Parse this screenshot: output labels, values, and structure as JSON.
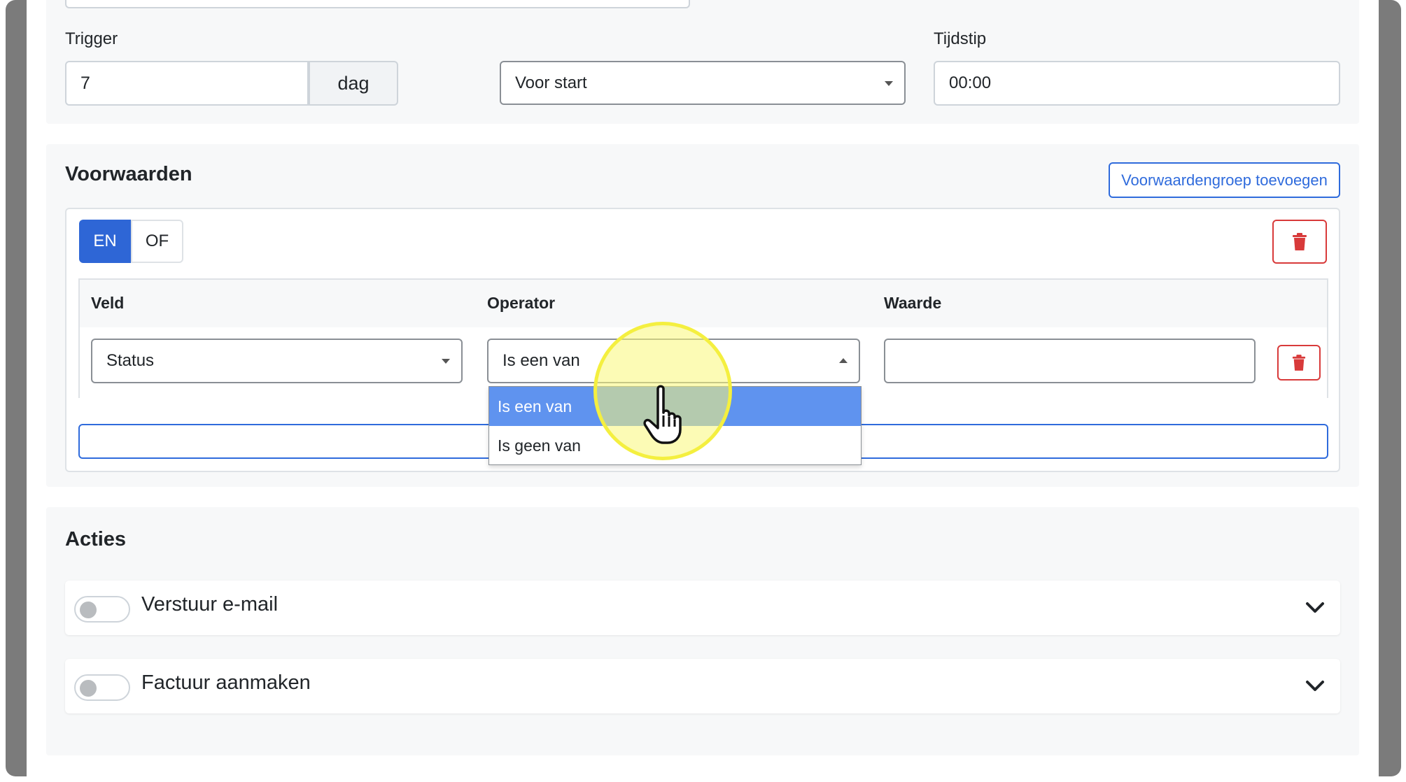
{
  "trigger": {
    "label": "Trigger",
    "amount_value": "7",
    "unit": "dag",
    "relation_value": "Voor start",
    "time_label": "Tijdstip",
    "time_value": "00:00"
  },
  "voorwaarden": {
    "title": "Voorwaarden",
    "add_group_label": "Voorwaardengroep toevoegen",
    "logic": {
      "and_label": "EN",
      "or_label": "OF",
      "selected": "EN"
    },
    "table": {
      "headers": [
        "Veld",
        "Operator",
        "Waarde"
      ],
      "row": {
        "field_value": "Status",
        "operator_value": "Is een van",
        "value_value": ""
      }
    },
    "operator_dropdown": {
      "open": true,
      "options": [
        "Is een van",
        "Is geen van"
      ],
      "selected": "Is een van"
    }
  },
  "acties": {
    "title": "Acties",
    "items": [
      {
        "label": "Verstuur e-mail",
        "enabled": false
      },
      {
        "label": "Factuur aanmaken",
        "enabled": false
      }
    ]
  },
  "colors": {
    "primary": "#2e66d6",
    "danger": "#d83a3a",
    "dropdown_active": "#5f93ef",
    "highlight": "#f4ef3f",
    "panel": "#f7f8f9"
  },
  "icons": [
    "trash-icon",
    "chevron-down-icon",
    "caret-down-icon",
    "caret-up-icon",
    "pointer-hand-icon"
  ]
}
